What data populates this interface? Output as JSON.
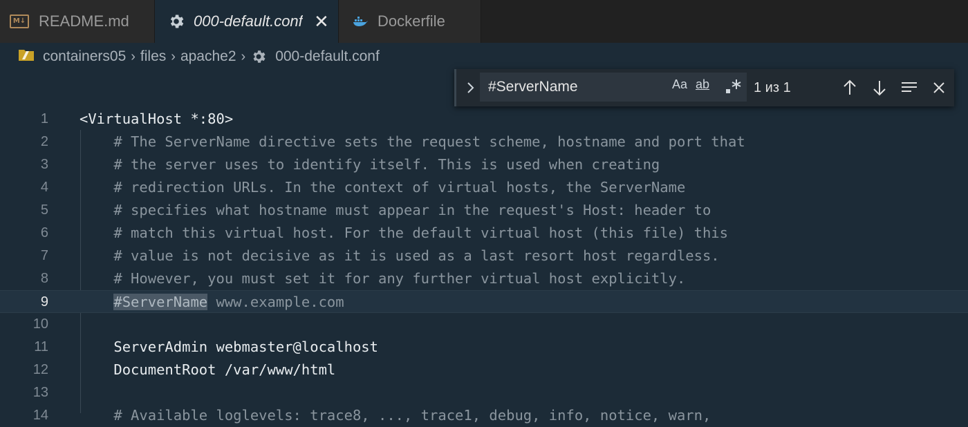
{
  "tabs": [
    {
      "label": "README.md",
      "icon": "markdown-icon",
      "active": false
    },
    {
      "label": "000-default.conf",
      "icon": "gear-icon",
      "active": true
    },
    {
      "label": "Dockerfile",
      "icon": "docker-icon",
      "active": false
    }
  ],
  "breadcrumb": {
    "items": [
      "containers05",
      "files",
      "apache2",
      "000-default.conf"
    ]
  },
  "find": {
    "query": "#ServerName",
    "match_case": "Aa",
    "whole_word": "ab",
    "count": "1 из 1"
  },
  "editor": {
    "current_line": 9,
    "lines": [
      {
        "n": "1",
        "text": "<VirtualHost *:80>"
      },
      {
        "n": "2",
        "text": "    # The ServerName directive sets the request scheme, hostname and port that"
      },
      {
        "n": "3",
        "text": "    # the server uses to identify itself. This is used when creating"
      },
      {
        "n": "4",
        "text": "    # redirection URLs. In the context of virtual hosts, the ServerName"
      },
      {
        "n": "5",
        "text": "    # specifies what hostname must appear in the request's Host: header to"
      },
      {
        "n": "6",
        "text": "    # match this virtual host. For the default virtual host (this file) this"
      },
      {
        "n": "7",
        "text": "    # value is not decisive as it is used as a last resort host regardless."
      },
      {
        "n": "8",
        "text": "    # However, you must set it for any further virtual host explicitly."
      },
      {
        "n": "9",
        "match": "#ServerName",
        "rest": " www.example.com"
      },
      {
        "n": "10",
        "text": ""
      },
      {
        "n": "11",
        "text": "    ServerAdmin webmaster@localhost"
      },
      {
        "n": "12",
        "text": "    DocumentRoot /var/www/html"
      },
      {
        "n": "13",
        "text": ""
      },
      {
        "n": "14",
        "text": "    # Available loglevels: trace8, ..., trace1, debug, info, notice, warn,"
      }
    ]
  },
  "colors": {
    "editor_bg": "#1c2b37",
    "tab_bar_bg": "#212121",
    "comment": "#8a959e",
    "find_match": "#4b5966"
  }
}
